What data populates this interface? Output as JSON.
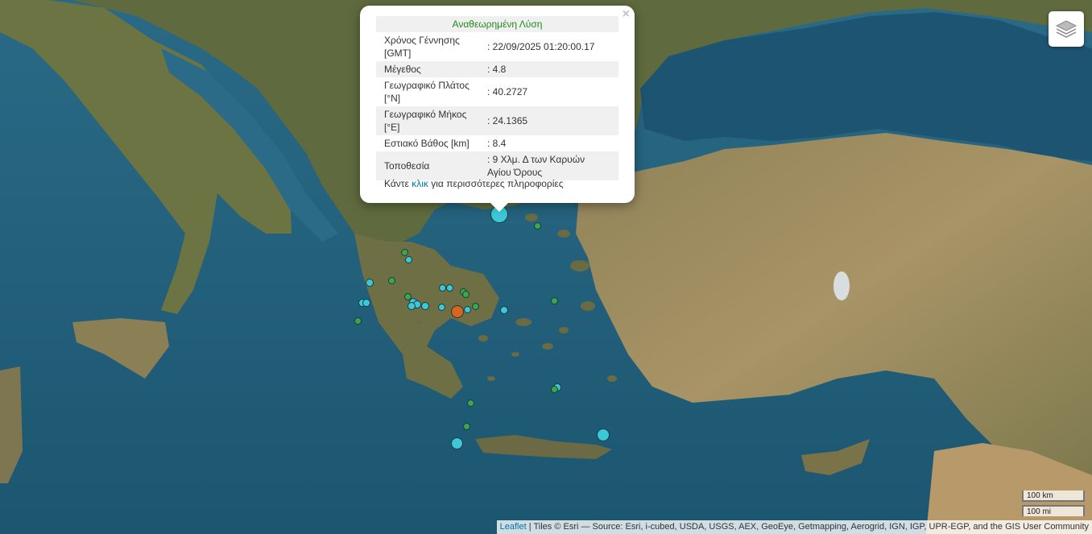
{
  "popup": {
    "header": "Αναθεωρημένη Λύση",
    "close": "×",
    "rows": [
      {
        "label": "Χρόνος Γέννησης [GMT]",
        "value": ": 22/09/2025 01:20:00.17"
      },
      {
        "label": "Μέγεθος",
        "value": ": 4.8"
      },
      {
        "label": "Γεωγραφικό Πλάτος [°N]",
        "value": ": 40.2727"
      },
      {
        "label": "Γεωγραφικό Μήκος [°E]",
        "value": ": 24.1365"
      },
      {
        "label": "Εστιακό Βάθος [km]",
        "value": ": 8.4"
      },
      {
        "label": "Τοποθεσία",
        "value": ": 9 Χλμ. Δ των Καρυών Αγίου Όρους"
      }
    ],
    "more_prefix": "Κάντε",
    "more_link": "κλικ",
    "more_suffix": "για περισσότερες πληροφορίες"
  },
  "layers_control": {
    "icon": "layers-icon"
  },
  "scale": {
    "km": "100 km",
    "mi": "100 mi"
  },
  "attribution": {
    "leaflet": "Leaflet",
    "text": "| Tiles © Esri — Source: Esri, i-cubed, USDA, USGS, AEX, GeoEye, Getmapping, Aerogrid, IGN, IGP, UPR-EGP, and the GIS User Community"
  },
  "colors": {
    "sea": "#1f5a74",
    "land": "#8a7a52",
    "popup_header": "#1d8a1d",
    "link": "#0078a8",
    "quake_recent": "#3cc8d8",
    "quake_older": "#3aa84a",
    "quake_strong": "#d8641e"
  }
}
